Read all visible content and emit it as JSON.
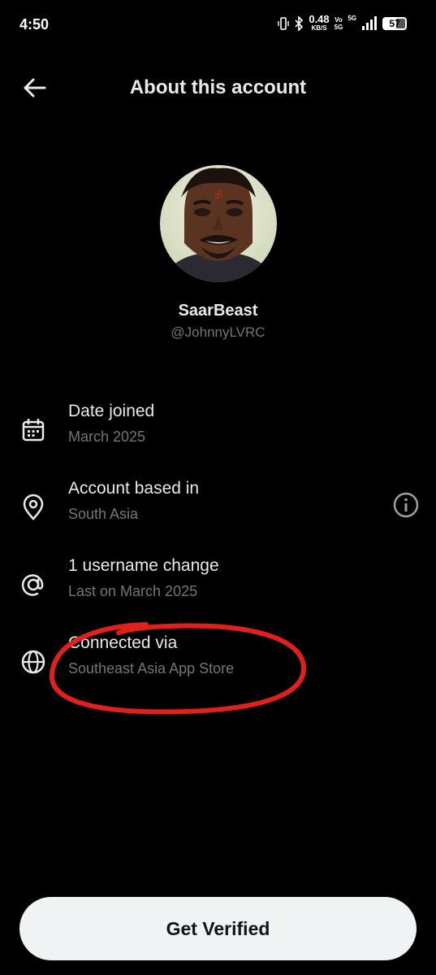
{
  "status_bar": {
    "time": "4:50",
    "net_speed": "0.48",
    "net_unit": "KB/S",
    "volte_top": "Vo",
    "volte_bottom": "5G",
    "network": "5G",
    "battery": "57"
  },
  "header": {
    "title": "About this account",
    "back_icon": "arrow-left-icon"
  },
  "profile": {
    "display_name": "SaarBeast",
    "handle": "@JohnnyLVRC"
  },
  "details": [
    {
      "icon": "calendar-icon",
      "label": "Date joined",
      "value": "March 2025"
    },
    {
      "icon": "location-pin-icon",
      "label": "Account based in",
      "value": "South Asia",
      "action_icon": "info-circle-icon"
    },
    {
      "icon": "at-sign-icon",
      "label": "1 username change",
      "value": "Last on March 2025"
    },
    {
      "icon": "globe-icon",
      "label": "Connected via",
      "value": "Southeast Asia App Store"
    }
  ],
  "footer": {
    "cta_label": "Get Verified"
  },
  "colors": {
    "background": "#000000",
    "primary_text": "#e7e9ea",
    "secondary_text": "#71767b",
    "button_bg": "#eff3f4",
    "annotation": "#e0201b"
  }
}
